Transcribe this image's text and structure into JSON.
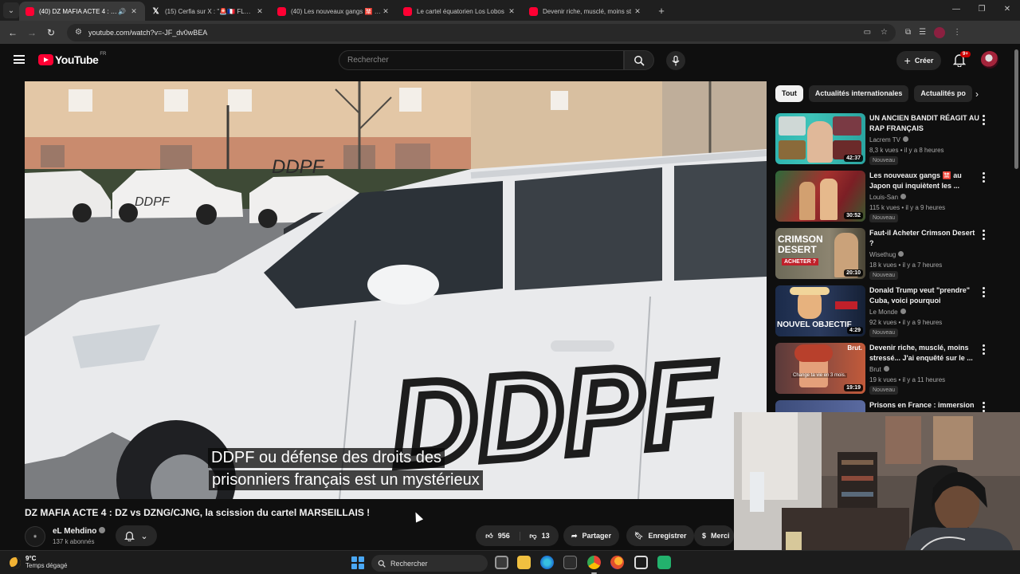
{
  "browser": {
    "tabs": [
      {
        "title": "(40) DZ MAFIA ACTE 4 : DZ",
        "icon": "youtube-icon",
        "active": true,
        "audio": true
      },
      {
        "title": "(15) Cerfia sur X : \"🚨🇫🇷 FLASH",
        "icon": "x-icon",
        "active": false
      },
      {
        "title": "(40) Les nouveaux gangs 🈲 au",
        "icon": "youtube-icon",
        "active": false
      },
      {
        "title": "Le cartel équatorien Los Lobos",
        "icon": "youtube-icon",
        "active": false
      },
      {
        "title": "Devenir riche, musclé, moins st",
        "icon": "youtube-icon",
        "active": false
      }
    ],
    "url": "youtube.com/watch?v=-JF_dv0wBEA"
  },
  "youtube": {
    "logo_text": "YouTube",
    "region": "FR",
    "search_placeholder": "Rechercher",
    "create_label": "Créer",
    "notif_count": "9+"
  },
  "video": {
    "subtitle_line1": "DDPF ou défense des droits des",
    "subtitle_line2": "prisonniers français est un mystérieux",
    "graffiti": "DDPF",
    "title": "DZ MAFIA ACTE 4 : DZ vs DZNG/CJNG, la scission du cartel MARSEILLAIS !",
    "channel": "eL Mehdino",
    "subscribers": "137 k abonnés",
    "likes": "956",
    "dislikes": "13",
    "share_label": "Partager",
    "save_label": "Enregistrer",
    "thanks_label": "Merci"
  },
  "chips": [
    "Tout",
    "Actualités internationales",
    "Actualités po"
  ],
  "recommendations": [
    {
      "title": "UN ANCIEN BANDIT RÉAGIT AU RAP FRANÇAIS",
      "channel": "Lacrem TV",
      "meta": "8,3 k vues • il y a 8 heures",
      "badge": "Nouveau",
      "duration": "42:37"
    },
    {
      "title": "Les nouveaux gangs 🈲 au Japon qui inquiètent les ...",
      "channel": "Louis-San",
      "meta": "115 k vues • il y a 9 heures",
      "badge": "Nouveau",
      "duration": "30:52"
    },
    {
      "title": "Faut-il Acheter Crimson Desert ?",
      "channel": "Wisethug",
      "meta": "18 k vues • il y a 7 heures",
      "badge": "Nouveau",
      "duration": "20:10",
      "thumb_text": "CRIMSON DESERT",
      "thumb_tag": "ACHETER ?"
    },
    {
      "title": "Donald Trump veut \"prendre\" Cuba, voici pourquoi",
      "channel": "Le Monde",
      "meta": "92 k vues • il y a 9 heures",
      "badge": "Nouveau",
      "duration": "4:29",
      "thumb_text": "NOUVEL OBJECTIF"
    },
    {
      "title": "Devenir riche, musclé, moins stressé... J'ai enquêté sur le ...",
      "channel": "Brut",
      "meta": "19 k vues • il y a 11 heures",
      "badge": "Nouveau",
      "duration": "19:19",
      "thumb_text": "Change ta vie en 3 mois.",
      "thumb_tag": "Brut."
    },
    {
      "title": "Prisons en France : immersion",
      "channel": "",
      "meta": "",
      "badge": "",
      "duration": ""
    }
  ],
  "taskbar": {
    "temp": "9°C",
    "condition": "Temps dégagé",
    "search_label": "Rechercher"
  },
  "colors": {
    "yt_red": "#ff0033",
    "bg": "#0f0f0f",
    "chip": "#272727"
  }
}
